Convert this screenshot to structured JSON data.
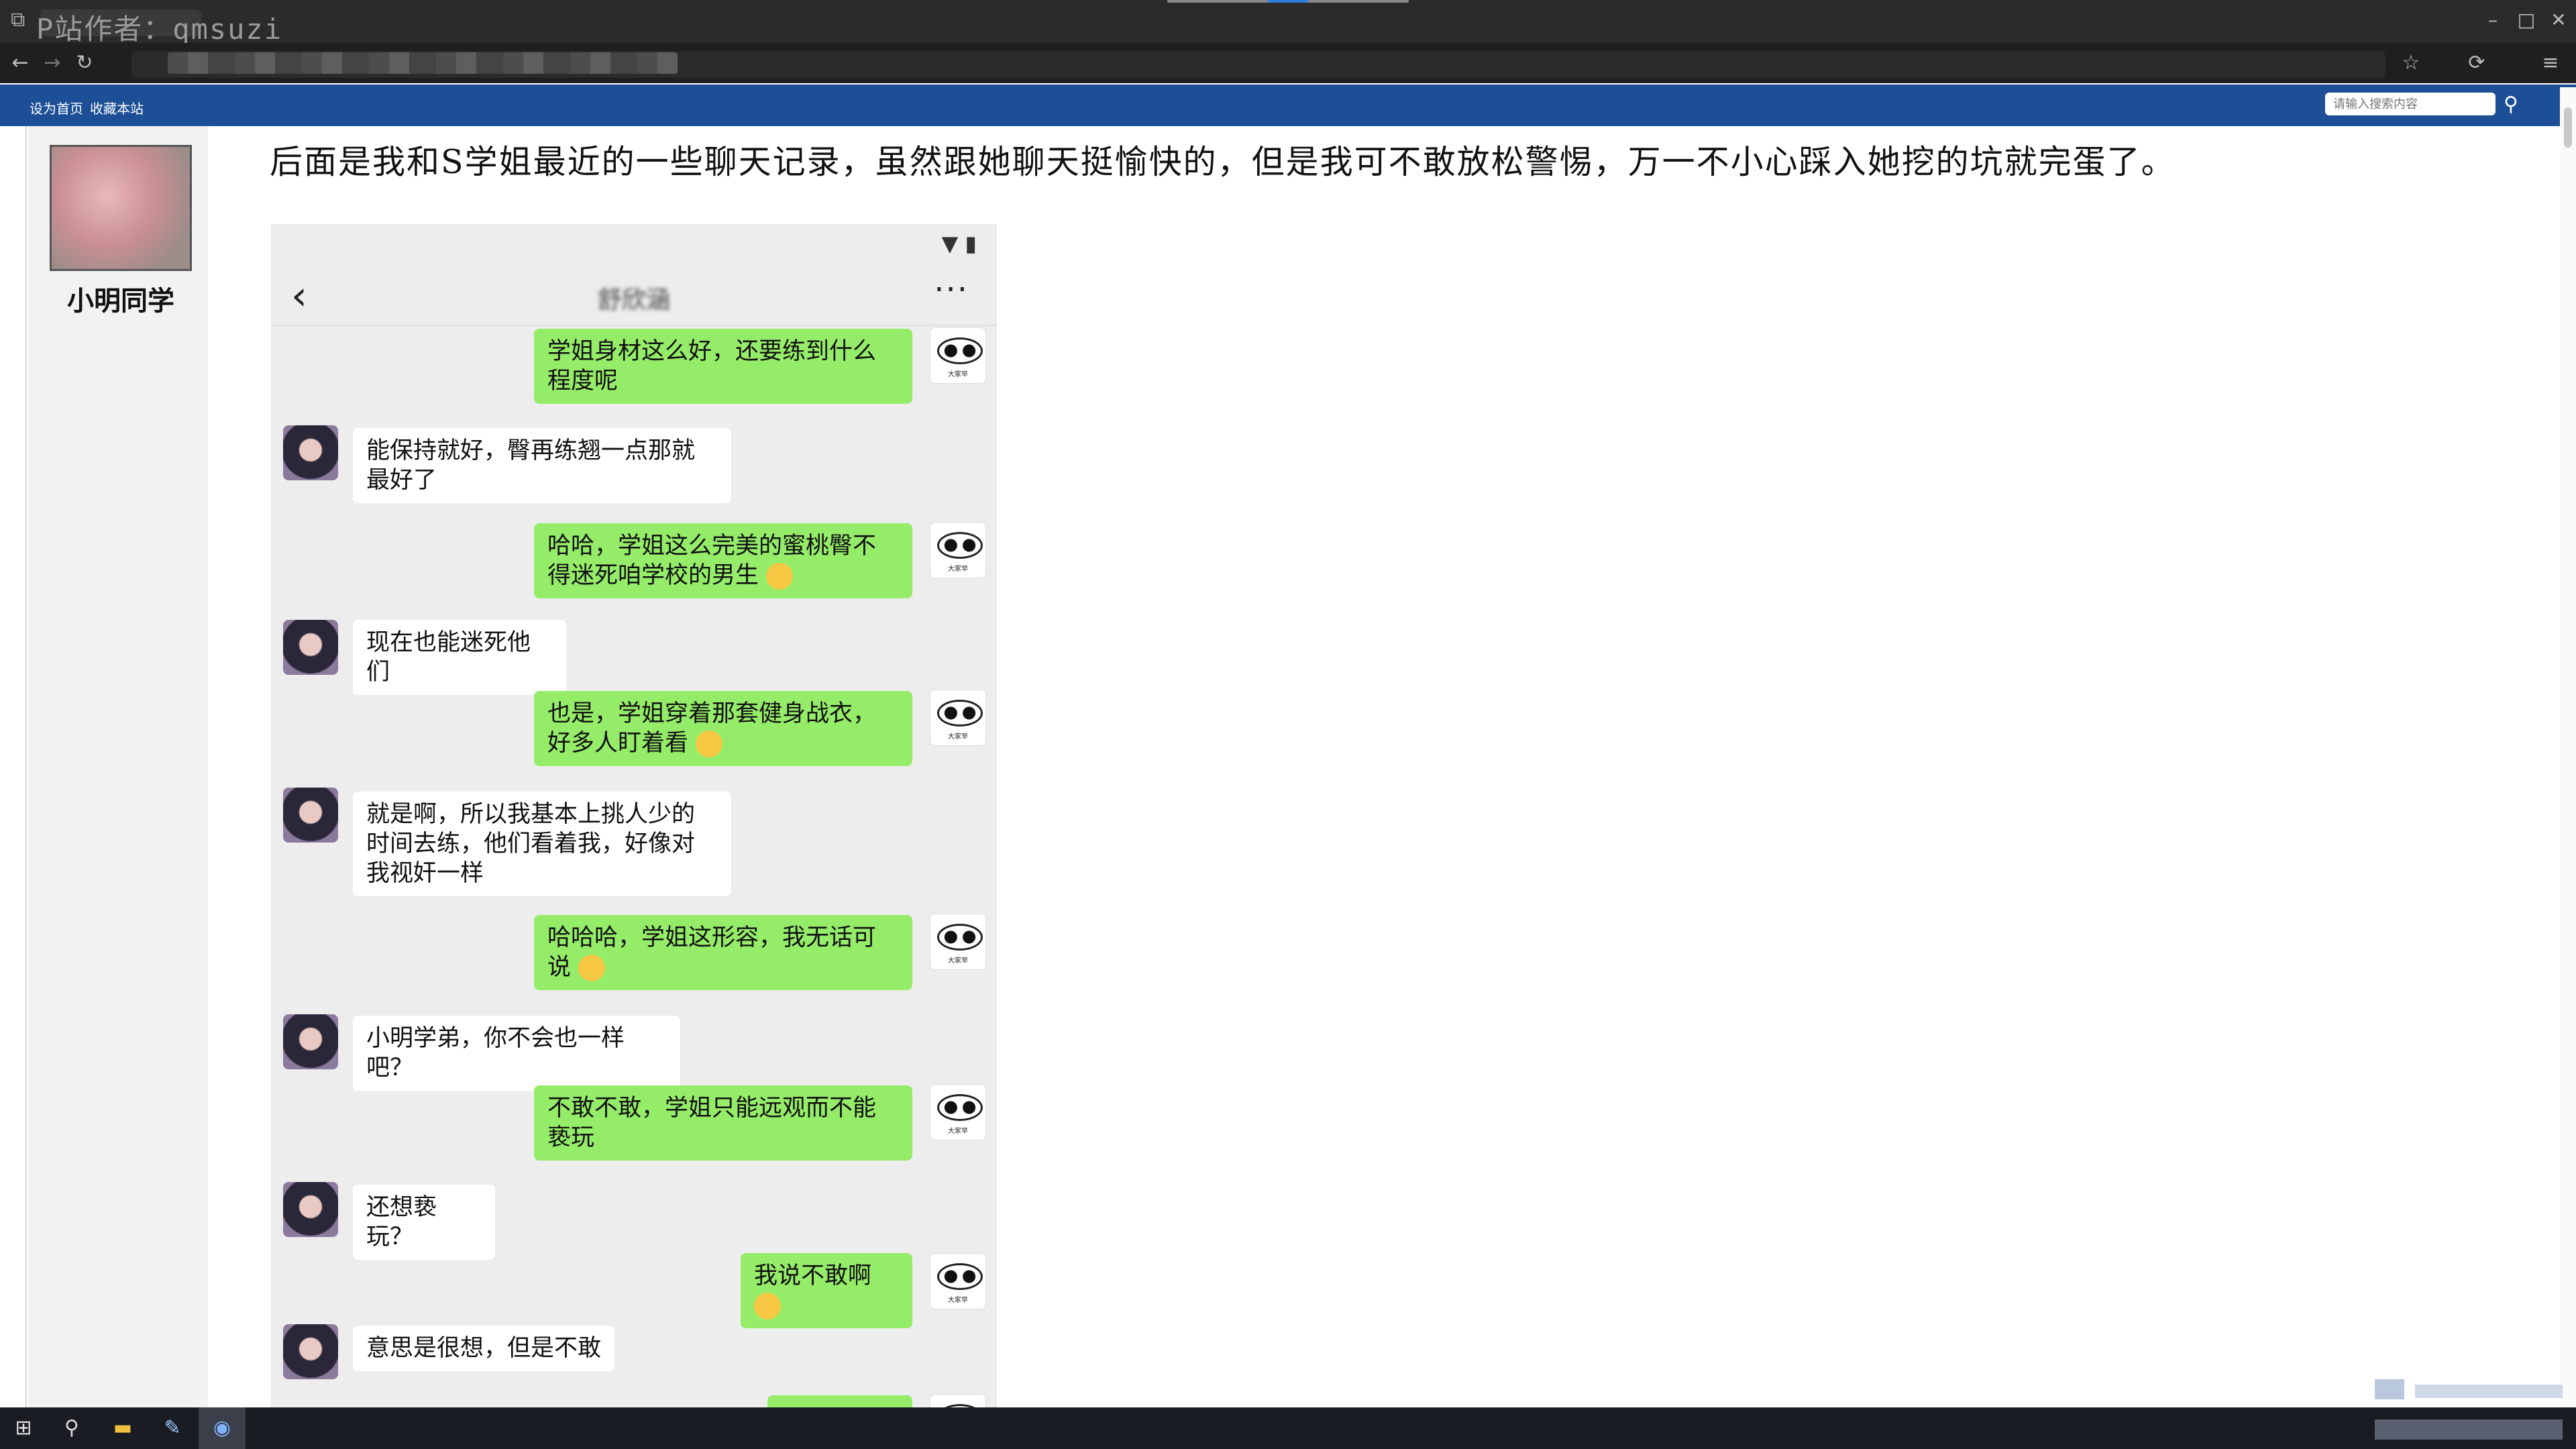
{
  "browser": {
    "watermark": "P站作者：qmsuzi",
    "tab_icon": "tab-icon",
    "back_icon": "←",
    "forward_icon": "→",
    "reload_icon": "↻",
    "star_icon": "☆",
    "extensions_icon": "⟳",
    "menu_icon": "≡",
    "minimize": "–",
    "maximize": "□",
    "close": "✕"
  },
  "site_nav": {
    "set_home": "设为首页",
    "bookmark": "收藏本站",
    "search_placeholder": "请输入搜索内容"
  },
  "author": {
    "name": "小明同学"
  },
  "article": {
    "headline": "后面是我和S学姐最近的一些聊天记录，虽然跟她聊天挺愉快的，但是我可不敢放松警惕，万一不小心踩入她挖的坑就完蛋了。"
  },
  "chat": {
    "contact_name": "舒欣涵",
    "back_icon": "‹",
    "more_icon": "···",
    "status_icons": "▼ ▮",
    "messages": [
      {
        "from": "me",
        "text": "学姐身材这么好，还要练到什么程度呢"
      },
      {
        "from": "her",
        "text": "能保持就好，臀再练翘一点那就最好了"
      },
      {
        "from": "me",
        "text": "哈哈，学姐这么完美的蜜桃臀不得迷死咱学校的男生"
      },
      {
        "from": "her",
        "text": "现在也能迷死他们"
      },
      {
        "from": "me",
        "text": "也是，学姐穿着那套健身战衣，好多人盯着看"
      },
      {
        "from": "her",
        "text": "就是啊，所以我基本上挑人少的时间去练，他们看着我，好像对我视奸一样"
      },
      {
        "from": "me",
        "text": "哈哈哈，学姐这形容，我无话可说"
      },
      {
        "from": "her",
        "text": "小明学弟，你不会也一样吧？"
      },
      {
        "from": "me",
        "text": "不敢不敢，学姐只能远观而不能亵玩"
      },
      {
        "from": "her",
        "text": "还想亵玩？"
      },
      {
        "from": "me",
        "text": "我说不敢啊"
      },
      {
        "from": "her",
        "text": "意思是很想，但是不敢"
      }
    ]
  },
  "colors": {
    "nav_blue": "#1c4f96",
    "bubble_green": "#95ec69",
    "chat_bg": "#ededed"
  }
}
